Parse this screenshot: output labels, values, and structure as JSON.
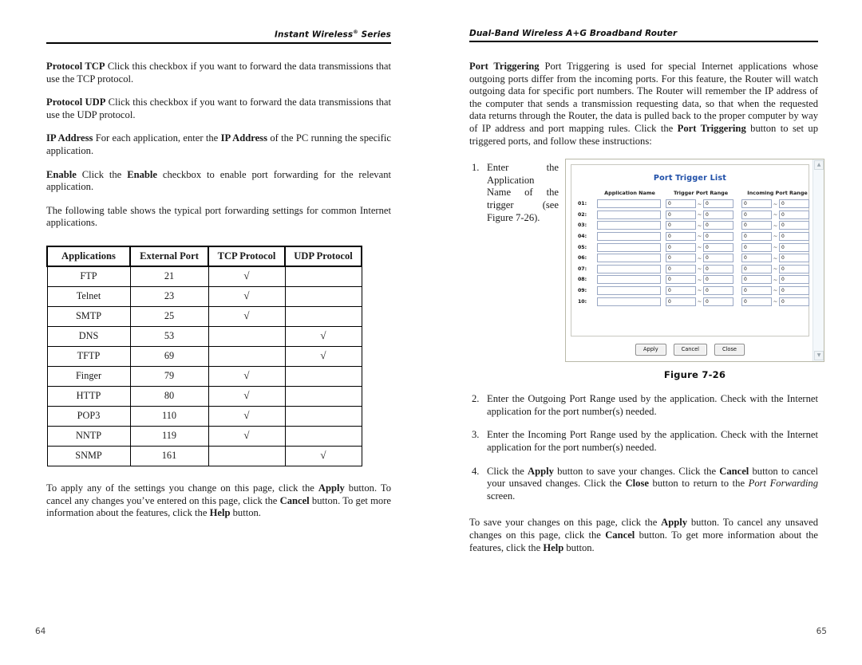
{
  "left_page": {
    "running_head": "Instant Wireless",
    "running_head_sup": "®",
    "running_head_tail": " Series",
    "folio": "64",
    "paragraphs": {
      "p_tcp_label": "Protocol TCP",
      "p_tcp_text": "  Click this checkbox if you want to forward the data transmissions that use the TCP protocol.",
      "p_udp_label": "Protocol UDP",
      "p_udp_text": " Click this checkbox if you want to forward the data transmissions that use the UDP protocol.",
      "p_ip_label": "IP Address",
      "p_ip_text_a": "  For each application, enter the ",
      "p_ip_bold": "IP Address",
      "p_ip_text_b": " of the PC running the specific application.",
      "p_enable_label": "Enable",
      "p_enable_text_a": "  Click the ",
      "p_enable_bold": "Enable",
      "p_enable_text_b": " checkbox to enable port forwarding for the relevant application.",
      "p_intro": "The following table shows the typical port forwarding settings for common Internet applications.",
      "p_footer_a": "To apply any of the settings you change on this page, click the ",
      "p_footer_apply": "Apply",
      "p_footer_b": " button.  To cancel any changes you’ve entered on this page, click the ",
      "p_footer_cancel": "Cancel",
      "p_footer_c": " button. To get more information about the features, click the ",
      "p_footer_help": "Help",
      "p_footer_d": " button."
    },
    "table": {
      "check_glyph": "√",
      "headers": [
        "Applications",
        "External Port",
        "TCP Protocol",
        "UDP Protocol"
      ],
      "rows": [
        {
          "app": "FTP",
          "port": "21",
          "tcp": true,
          "udp": false
        },
        {
          "app": "Telnet",
          "port": "23",
          "tcp": true,
          "udp": false
        },
        {
          "app": "SMTP",
          "port": "25",
          "tcp": true,
          "udp": false
        },
        {
          "app": "DNS",
          "port": "53",
          "tcp": false,
          "udp": true
        },
        {
          "app": "TFTP",
          "port": "69",
          "tcp": false,
          "udp": true
        },
        {
          "app": "Finger",
          "port": "79",
          "tcp": true,
          "udp": false
        },
        {
          "app": "HTTP",
          "port": "80",
          "tcp": true,
          "udp": false
        },
        {
          "app": "POP3",
          "port": "110",
          "tcp": true,
          "udp": false
        },
        {
          "app": "NNTP",
          "port": "119",
          "tcp": true,
          "udp": false
        },
        {
          "app": "SNMP",
          "port": "161",
          "tcp": false,
          "udp": true
        }
      ]
    }
  },
  "right_page": {
    "running_head": "Dual-Band Wireless A+G Broadband Router",
    "folio": "65",
    "paragraphs": {
      "p_trigger_label": "Port Triggering",
      "p_trigger_text_a": "  Port Triggering is used for special Internet applications whose outgoing ports differ from the incoming ports. For this feature, the Router will watch outgoing data for specific port numbers. The Router will remember the IP address of the computer that sends a transmission requesting data, so that when the requested data returns through the Router, the data is pulled back to the proper computer by way of IP address and port mapping rules. Click the ",
      "p_trigger_bold2": "Port Triggering",
      "p_trigger_text_b": " button to set up triggered ports, and follow these instructions:",
      "p_footer_a": "To save your changes on this page, click the ",
      "p_footer_apply": "Apply",
      "p_footer_b": " button. To cancel any unsaved changes on this page, click the ",
      "p_footer_cancel": "Cancel",
      "p_footer_c": " button. To get more information about the features, click the ",
      "p_footer_help": "Help",
      "p_footer_d": " button."
    },
    "steps": [
      {
        "marker": "1.",
        "text": "Enter the Application Name of the trigger (see Figure 7-26)."
      },
      {
        "marker": "2.",
        "text": "Enter the Outgoing Port Range used by the application. Check with the Internet application for the port number(s) needed."
      },
      {
        "marker": "3.",
        "text": "Enter the Incoming Port Range used by the application. Check with the Internet application for the port number(s) needed."
      }
    ],
    "step4": {
      "marker": "4.",
      "a": "Click the ",
      "apply": "Apply",
      "b": " button to save your changes. Click the ",
      "cancel": "Cancel",
      "c": " button to cancel your unsaved changes. Click the ",
      "close": "Close",
      "d": " button to return to the ",
      "screen_italic": "Port Forwarding",
      "e": " screen."
    },
    "figure": {
      "caption": "Figure 7-26",
      "dialog": {
        "title": "Port Trigger List",
        "title_color": "#1f4fa8",
        "columns": [
          "Application Name",
          "Trigger Port Range",
          "Incoming Port Range"
        ],
        "range_separator": "~",
        "rows": [
          {
            "index": "01:",
            "app_name": "",
            "trigger_start": "0",
            "trigger_end": "0",
            "incoming_start": "0",
            "incoming_end": "0"
          },
          {
            "index": "02:",
            "app_name": "",
            "trigger_start": "0",
            "trigger_end": "0",
            "incoming_start": "0",
            "incoming_end": "0"
          },
          {
            "index": "03:",
            "app_name": "",
            "trigger_start": "0",
            "trigger_end": "0",
            "incoming_start": "0",
            "incoming_end": "0"
          },
          {
            "index": "04:",
            "app_name": "",
            "trigger_start": "0",
            "trigger_end": "0",
            "incoming_start": "0",
            "incoming_end": "0"
          },
          {
            "index": "05:",
            "app_name": "",
            "trigger_start": "0",
            "trigger_end": "0",
            "incoming_start": "0",
            "incoming_end": "0"
          },
          {
            "index": "06:",
            "app_name": "",
            "trigger_start": "0",
            "trigger_end": "0",
            "incoming_start": "0",
            "incoming_end": "0"
          },
          {
            "index": "07:",
            "app_name": "",
            "trigger_start": "0",
            "trigger_end": "0",
            "incoming_start": "0",
            "incoming_end": "0"
          },
          {
            "index": "08:",
            "app_name": "",
            "trigger_start": "0",
            "trigger_end": "0",
            "incoming_start": "0",
            "incoming_end": "0"
          },
          {
            "index": "09:",
            "app_name": "",
            "trigger_start": "0",
            "trigger_end": "0",
            "incoming_start": "0",
            "incoming_end": "0"
          },
          {
            "index": "10:",
            "app_name": "",
            "trigger_start": "0",
            "trigger_end": "0",
            "incoming_start": "0",
            "incoming_end": "0"
          }
        ],
        "buttons": [
          "Apply",
          "Cancel",
          "Close"
        ],
        "scroll_up_glyph": "▲",
        "scroll_down_glyph": "▼"
      }
    }
  }
}
